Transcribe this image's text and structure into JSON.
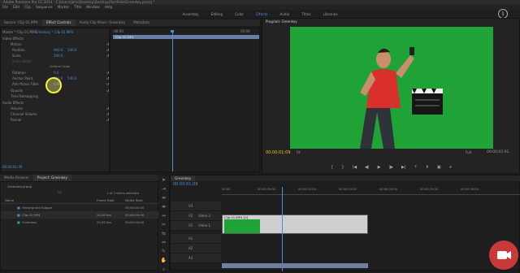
{
  "window": {
    "title": "Adobe Premiere Pro CC 2014 - C:\\Users\\John\\Desktop\\Desktop\\Portfolio\\Greenkey.prproj *",
    "menu": [
      "File",
      "Edit",
      "Clip",
      "Sequence",
      "Marker",
      "Title",
      "Window",
      "Help"
    ],
    "workspaces": [
      "Assembly",
      "Editing",
      "Color",
      "Effects",
      "Audio",
      "Titles",
      "Libraries"
    ],
    "active_workspace": "Effects"
  },
  "effect_controls": {
    "tabs": [
      "Source: Clip 01.MP4",
      "Effect Controls",
      "Audio Clip Mixer: Greenkey",
      "Metadata"
    ],
    "header": "Master * Clip 01.MP4",
    "sequence_ref": "Greenkey * Clip 01.MP4",
    "section_video": "Video Effects",
    "motion": "Motion",
    "position": "Position",
    "scale": "Scale",
    "scale_width": "Scale Width",
    "position_x": "960.0",
    "position_y": "540.0",
    "scale_value": "100.0",
    "uniform_scale": "Uniform Scale",
    "rotation": "Rotation",
    "rotation_value": "0.0",
    "anchor": "Anchor Point",
    "anchor_x": "960.0",
    "anchor_y": "540.0",
    "antiflicker": "Anti-flicker Filter",
    "antiflicker_value": "0.00",
    "opacity": "Opacity",
    "time_remap": "Time Remapping",
    "section_audio": "Audio Effects",
    "volume": "Volume",
    "channel_volume": "Channel Volume",
    "panner": "Panner",
    "timecode": "00:00:01:09",
    "ruler_start": ":00:00",
    "ruler_end": "00:00",
    "clip_label": "Clip 01.MP4"
  },
  "program_monitor": {
    "title": "Program: Greenkey",
    "timecode": "00:00:01:09",
    "fit": "Fit",
    "quality": "Full",
    "duration": "00:00:03:01"
  },
  "project": {
    "tabs": [
      "Media Browser",
      "Project: Greenkey"
    ],
    "file": "Greenkey.prproj",
    "count": "1 of 3 items selected",
    "columns": {
      "name": "Name",
      "frame_rate": "Frame Rate",
      "media_start": "Media Start"
    },
    "rows": [
      {
        "name": "Hintergrund Klappe",
        "rate": "",
        "start": "00:00:00:00"
      },
      {
        "name": "Clip 01.MP4",
        "rate": "25,00 fps",
        "start": "00:00:00:00"
      },
      {
        "name": "Greenkey",
        "rate": "25,00 fps",
        "start": "00:00:00:00"
      }
    ]
  },
  "timeline": {
    "tab": "Greenkey",
    "timecode": "00:00:01:09",
    "ruler": [
      "00:00",
      "00:00:05:00",
      "00:00:10:00",
      "00:00:15:00",
      "00:00:20:00",
      "00:00:25:00",
      "00:00:30:00"
    ],
    "tracks": [
      "V3",
      "V2",
      "V1",
      "A1",
      "A2",
      "A3"
    ],
    "track_names": {
      "v2": "Video 2",
      "v1": "Video 1"
    },
    "clip": "Clip 01.MP4 [V]"
  }
}
